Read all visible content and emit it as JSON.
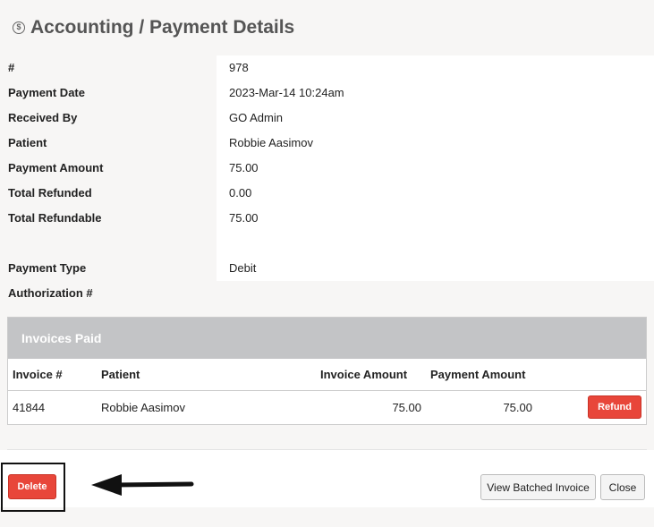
{
  "header": {
    "title": "Accounting / Payment Details",
    "icon": "$"
  },
  "details": [
    {
      "label": "#",
      "value": "978"
    },
    {
      "label": "Payment Date",
      "value": "2023-Mar-14 10:24am"
    },
    {
      "label": "Received By",
      "value": "GO Admin"
    },
    {
      "label": "Patient",
      "value": "Robbie Aasimov"
    },
    {
      "label": "Payment Amount",
      "value": "75.00"
    },
    {
      "label": "Total Refunded",
      "value": "0.00"
    },
    {
      "label": "Total Refundable",
      "value": "75.00"
    },
    {
      "label": "",
      "value": ""
    },
    {
      "label": "Payment Type",
      "value": "Debit"
    },
    {
      "label": "Authorization #",
      "value": ""
    }
  ],
  "invoices": {
    "title": "Invoices Paid",
    "columns": [
      "Invoice #",
      "Patient",
      "Invoice Amount",
      "Payment Amount",
      ""
    ],
    "rows": [
      {
        "invoice": "41844",
        "patient": "Robbie Aasimov",
        "invoice_amount": "75.00",
        "payment_amount": "75.00",
        "action": "Refund"
      }
    ]
  },
  "buttons": {
    "delete": "Delete",
    "view_batched": "View Batched Invoice",
    "close": "Close"
  },
  "colors": {
    "danger": "#e8463a",
    "panel_header": "#c3c4c6"
  }
}
